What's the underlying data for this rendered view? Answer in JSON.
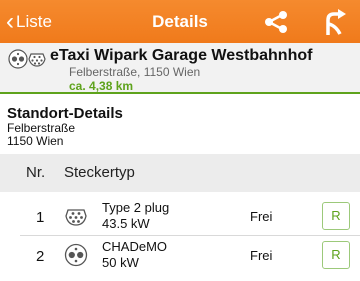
{
  "navbar": {
    "back_label": "Liste",
    "title": "Details",
    "color": "#f07a1b"
  },
  "station": {
    "name": "eTaxi Wipark Garage Westbahnhof",
    "address": "Felberstraße, 1150 Wien",
    "distance": "ca. 4,38 km",
    "accent": "#5ea31c"
  },
  "location": {
    "title": "Standort-Details",
    "street": "Felberstraße",
    "city": "1150 Wien"
  },
  "table": {
    "columns": {
      "nr": "Nr.",
      "type": "Steckertyp"
    },
    "rows": [
      {
        "nr": "1",
        "name": "Type 2 plug",
        "power": "43.5 kW",
        "status": "Frei",
        "action": "R",
        "icon": "type2-plug-icon"
      },
      {
        "nr": "2",
        "name": "CHADeMO",
        "power": "50 kW",
        "status": "Frei",
        "action": "R",
        "icon": "chademo-plug-icon"
      }
    ]
  }
}
